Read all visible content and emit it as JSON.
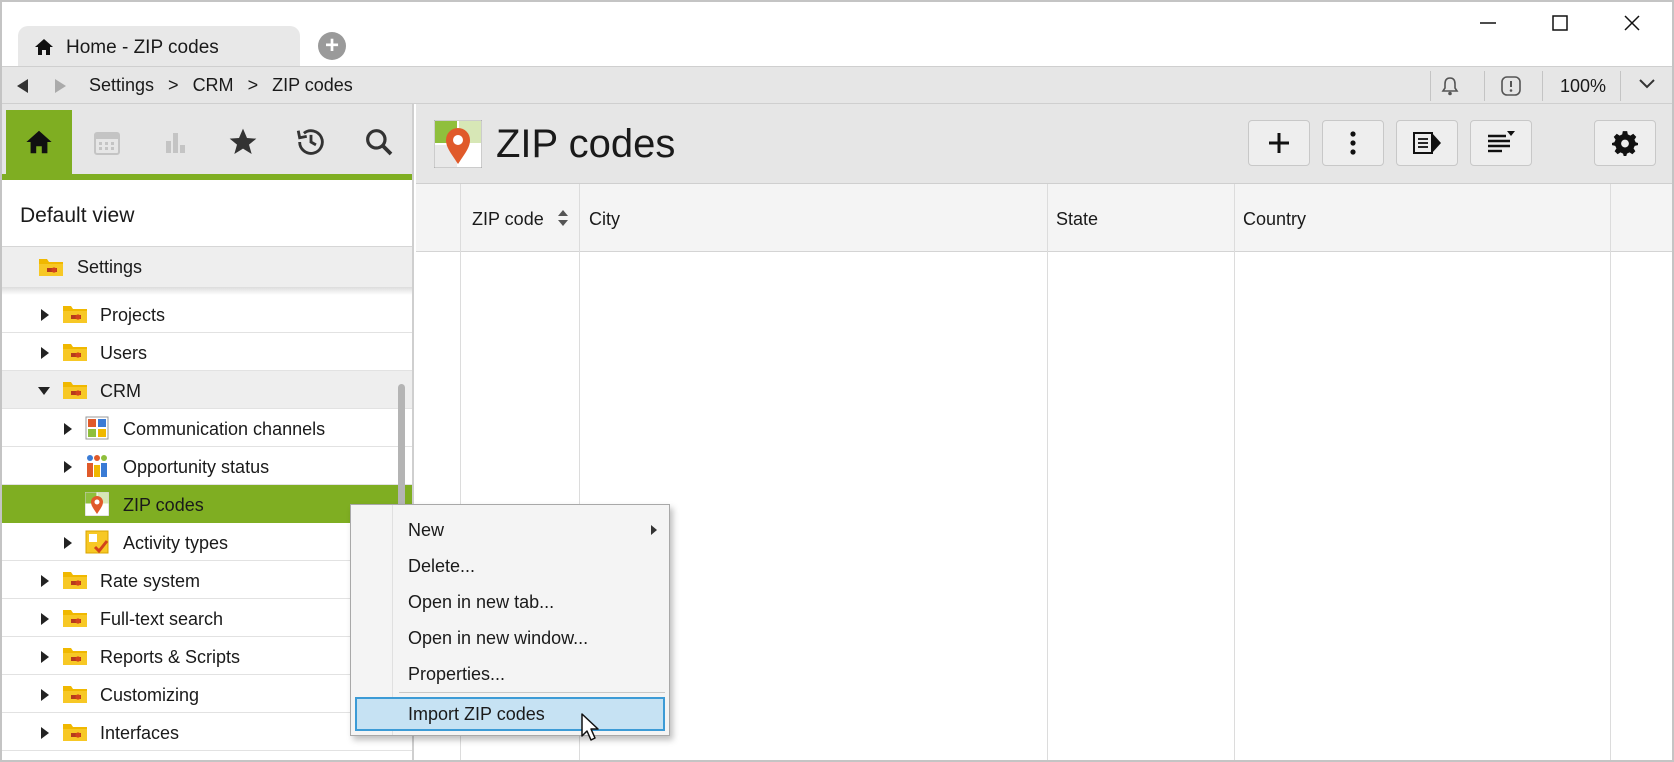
{
  "window": {
    "tab_title": "Home - ZIP codes",
    "new_tab_icon": "plus-circle-icon",
    "controls": [
      "minimize-icon",
      "maximize-icon",
      "close-icon"
    ]
  },
  "addressbar": {
    "breadcrumbs": [
      "Settings",
      ">",
      "CRM",
      ">",
      "ZIP codes"
    ],
    "zoom": "100%",
    "icons": [
      "back-arrow-icon",
      "forward-arrow-icon",
      "bell-icon",
      "info-alert-icon",
      "chevron-down-icon"
    ]
  },
  "sidebar": {
    "nav_icons": [
      "home-icon",
      "calendar-icon",
      "chart-icon",
      "star-icon",
      "history-icon",
      "search-icon"
    ],
    "view_label": "Default view",
    "root": "Settings",
    "tree": [
      {
        "label": "Projects",
        "level": 1,
        "state": "collapsed",
        "icon": "folder-icon"
      },
      {
        "label": "Users",
        "level": 1,
        "state": "collapsed",
        "icon": "folder-icon"
      },
      {
        "label": "CRM",
        "level": 1,
        "state": "expanded",
        "icon": "folder-icon"
      },
      {
        "label": "Communication channels",
        "level": 2,
        "state": "collapsed",
        "icon": "communication-icon"
      },
      {
        "label": "Opportunity status",
        "level": 2,
        "state": "collapsed",
        "icon": "opportunity-icon"
      },
      {
        "label": "ZIP codes",
        "level": 2,
        "state": "selected",
        "icon": "map-pin-icon"
      },
      {
        "label": "Activity types",
        "level": 2,
        "state": "collapsed",
        "icon": "activity-icon"
      },
      {
        "label": "Rate system",
        "level": 1,
        "state": "collapsed",
        "icon": "folder-icon"
      },
      {
        "label": "Full-text search",
        "level": 1,
        "state": "collapsed",
        "icon": "folder-icon"
      },
      {
        "label": "Reports & Scripts",
        "level": 1,
        "state": "collapsed",
        "icon": "folder-icon"
      },
      {
        "label": "Customizing",
        "level": 1,
        "state": "collapsed",
        "icon": "folder-icon"
      },
      {
        "label": "Interfaces",
        "level": 1,
        "state": "collapsed",
        "icon": "folder-icon"
      }
    ]
  },
  "main": {
    "title": "ZIP codes",
    "toolbar_icons": [
      "add-icon",
      "more-vertical-icon",
      "preview-pane-icon",
      "sort-lines-icon",
      "settings-gear-icon"
    ],
    "columns": [
      "ZIP code",
      "City",
      "State",
      "Country"
    ],
    "rows": []
  },
  "context_menu": {
    "items": [
      {
        "label": "New",
        "submenu": true
      },
      {
        "label": "Delete...",
        "submenu": false
      },
      {
        "label": "Open in new tab...",
        "submenu": false
      },
      {
        "label": "Open in new window...",
        "submenu": false
      },
      {
        "label": "Properties...",
        "submenu": false
      },
      {
        "label": "Import ZIP codes",
        "submenu": false,
        "highlighted": true
      }
    ]
  },
  "colors": {
    "accent_green": "#7fae22",
    "menu_highlight": "#c6e2f3",
    "menu_highlight_border": "#3c9bd6",
    "chrome_gray": "#e6e6e6"
  }
}
